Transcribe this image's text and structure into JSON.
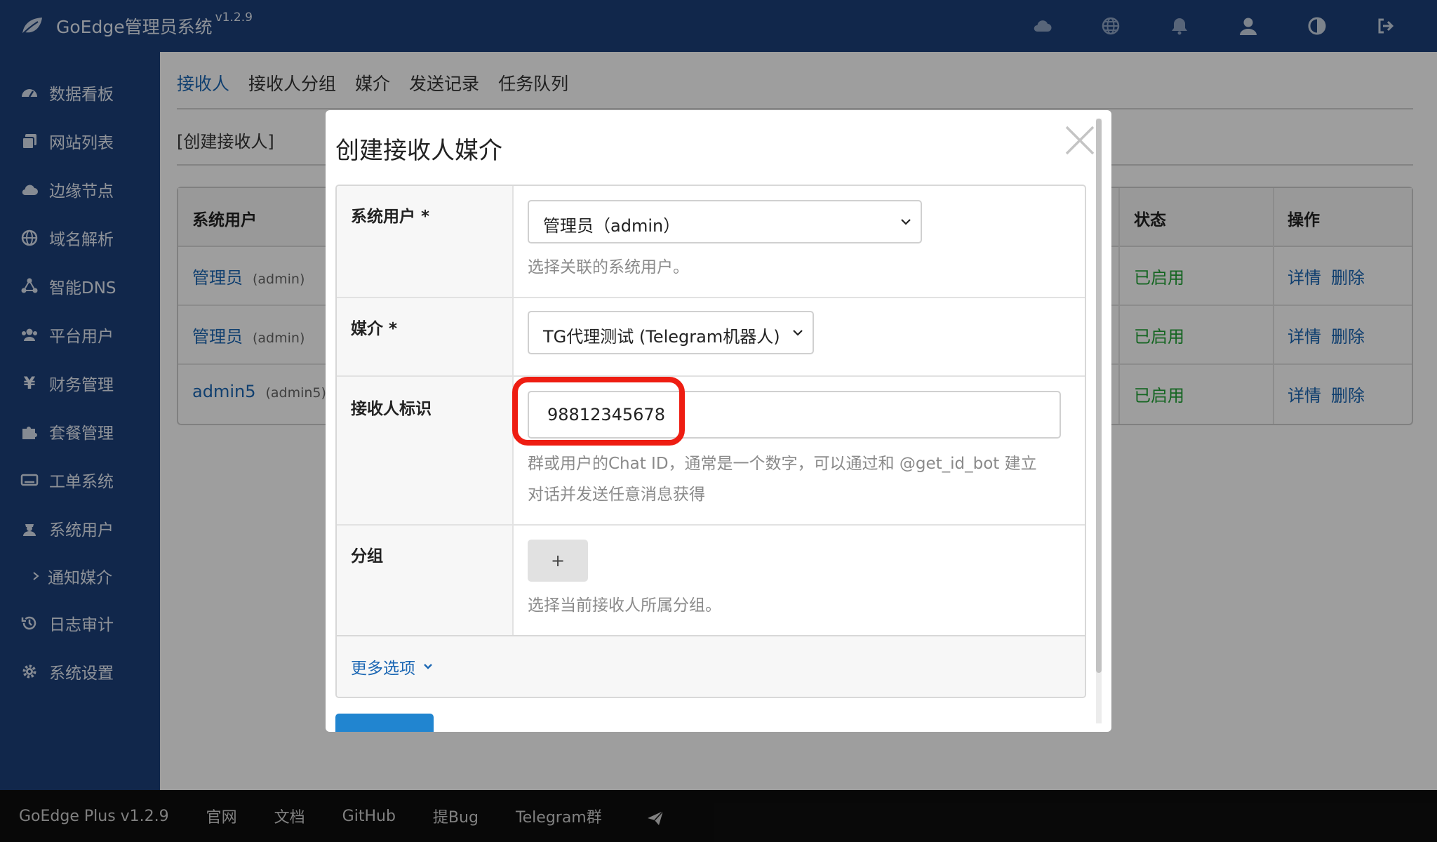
{
  "app": {
    "brand": "GoEdge管理员系统",
    "version": "v1.2.9"
  },
  "top_icons": [
    "cloud-icon",
    "globe-icon",
    "bell-icon",
    "user-icon",
    "contrast-icon",
    "logout-icon"
  ],
  "sidebar": {
    "items": [
      {
        "label": "数据看板",
        "icon": "dashboard-icon"
      },
      {
        "label": "网站列表",
        "icon": "copy-icon"
      },
      {
        "label": "边缘节点",
        "icon": "cloud-icon"
      },
      {
        "label": "域名解析",
        "icon": "globe-icon"
      },
      {
        "label": "智能DNS",
        "icon": "connectdevelop-icon"
      },
      {
        "label": "平台用户",
        "icon": "users-icon"
      },
      {
        "label": "财务管理",
        "icon": "yen-icon"
      },
      {
        "label": "套餐管理",
        "icon": "puzzle-icon"
      },
      {
        "label": "工单系统",
        "icon": "keyboard-icon"
      },
      {
        "label": "系统用户",
        "icon": "user-secret-icon"
      },
      {
        "label": "日志审计",
        "icon": "history-icon"
      },
      {
        "label": "系统设置",
        "icon": "gear-icon"
      }
    ],
    "sub_item": {
      "label": "通知媒介",
      "icon": "chevron-right-icon"
    }
  },
  "main": {
    "tabs": [
      "接收人",
      "接收人分组",
      "媒介",
      "发送记录",
      "任务队列"
    ],
    "active_tab": "接收人",
    "create_link": "[创建接收人]",
    "table": {
      "headers": {
        "user": "系统用户",
        "status": "状态",
        "ops": "操作"
      },
      "rows": [
        {
          "name": "管理员",
          "login": "(admin)",
          "status": "已启用",
          "detail": "详情",
          "delete": "删除"
        },
        {
          "name": "管理员",
          "login": "(admin)",
          "status": "已启用",
          "detail": "详情",
          "delete": "删除"
        },
        {
          "name": "admin5",
          "login": "(admin5)",
          "status": "已启用",
          "detail": "详情",
          "delete": "删除"
        }
      ]
    }
  },
  "modal": {
    "title": "创建接收人媒介",
    "fields": {
      "user": {
        "label": "系统用户 *",
        "value": "管理员（admin）",
        "hint": "选择关联的系统用户。"
      },
      "media": {
        "label": "媒介 *",
        "value": "TG代理测试 (Telegram机器人)"
      },
      "receiver": {
        "label": "接收人标识",
        "value": "98812345678",
        "hint_line1": "群或用户的Chat ID，通常是一个数字，可以通过和 @get_id_bot 建立",
        "hint_line2": "对话并发送任意消息获得"
      },
      "group": {
        "label": "分组",
        "add_label": "+",
        "hint": "选择当前接收人所属分组。"
      }
    },
    "more_options": "更多选项"
  },
  "footer": {
    "items": [
      "GoEdge Plus v1.2.9",
      "官网",
      "文档",
      "GitHub",
      "提Bug",
      "Telegram群"
    ]
  },
  "colors": {
    "nav": "#1c3f7a",
    "link": "#1a66b3",
    "enabled": "#21a336",
    "highlight": "#ee1d12",
    "footer": "#0e0e0e"
  }
}
